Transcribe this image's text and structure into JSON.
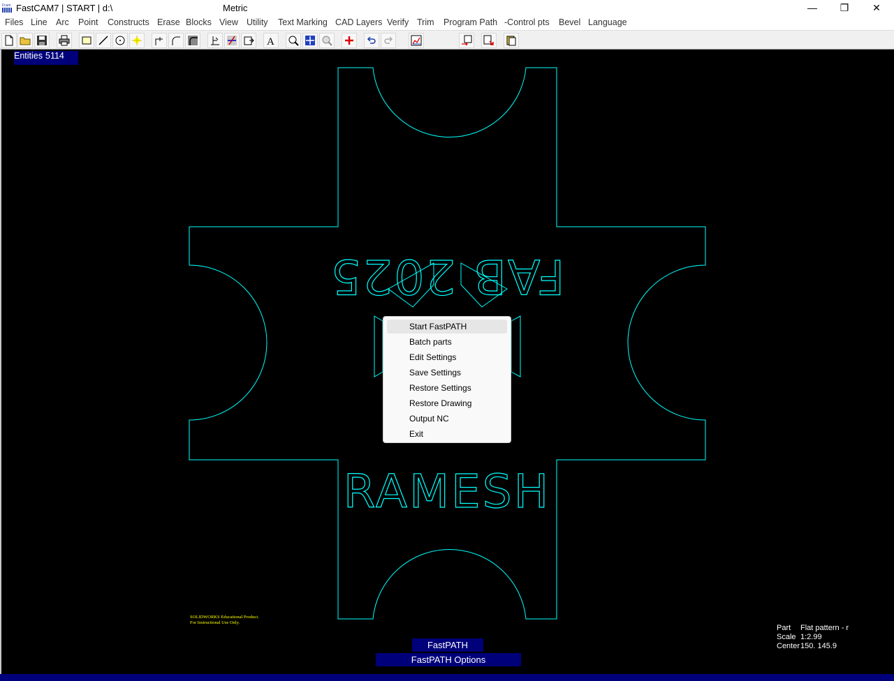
{
  "titlebar": {
    "app_title": "FastCAM7  |  START  |  d:\\",
    "units": "Metric",
    "minimize": "—",
    "maximize": "❐",
    "close": "✕"
  },
  "menu": [
    "Files",
    "Line",
    "Arc",
    "Point",
    "Constructs",
    "Erase",
    "Blocks",
    "View",
    "Utility",
    "Text Marking",
    "CAD Layers",
    "Verify",
    "Trim",
    "Program Path",
    "-Control pts",
    "Bevel",
    "Language"
  ],
  "toolbar_icons": [
    "new-file-icon",
    "open-folder-icon",
    "save-icon",
    "print-icon",
    "rectangle-icon",
    "line-icon",
    "circle-icon",
    "point-star-icon",
    "fillet-icon",
    "arc-icon",
    "chamfer-icon",
    "trim-icon",
    "cut-icon",
    "block-insert-icon",
    "text-icon",
    "zoom-window-icon",
    "zoom-all-icon",
    "zoom-previous-icon",
    "add-cross-icon",
    "undo-icon",
    "redo-icon",
    "chart-icon",
    "nc-output-icon",
    "export-icon",
    "library-icon"
  ],
  "status": {
    "entities_label": "Entities",
    "entities_count": "5114"
  },
  "drawing": {
    "text_top": "FAB 2025",
    "text_bottom": "RAMESH",
    "line_color": "#00ffff"
  },
  "edu_note": {
    "line1": "SOLIDWORKS Educational Product.",
    "line2": "For Instructional Use Only."
  },
  "context_menu": {
    "items": [
      "Start FastPATH",
      "Batch parts",
      "Edit Settings",
      "Save Settings",
      "Restore Settings",
      "Restore Drawing",
      "Output NC",
      "Exit"
    ]
  },
  "fastpath": {
    "label": "FastPATH",
    "options": "FastPATH Options"
  },
  "info": {
    "part_label": "Part",
    "part_value": "Flat pattern - r",
    "scale_label": "Scale",
    "scale_value": "1:2.99",
    "center_label": "Center",
    "center_value": "150. 145.9"
  },
  "colors": {
    "panel_blue": "#00007a",
    "drawing_cyan": "#00ffff",
    "edu_yellow": "#ffff00"
  }
}
